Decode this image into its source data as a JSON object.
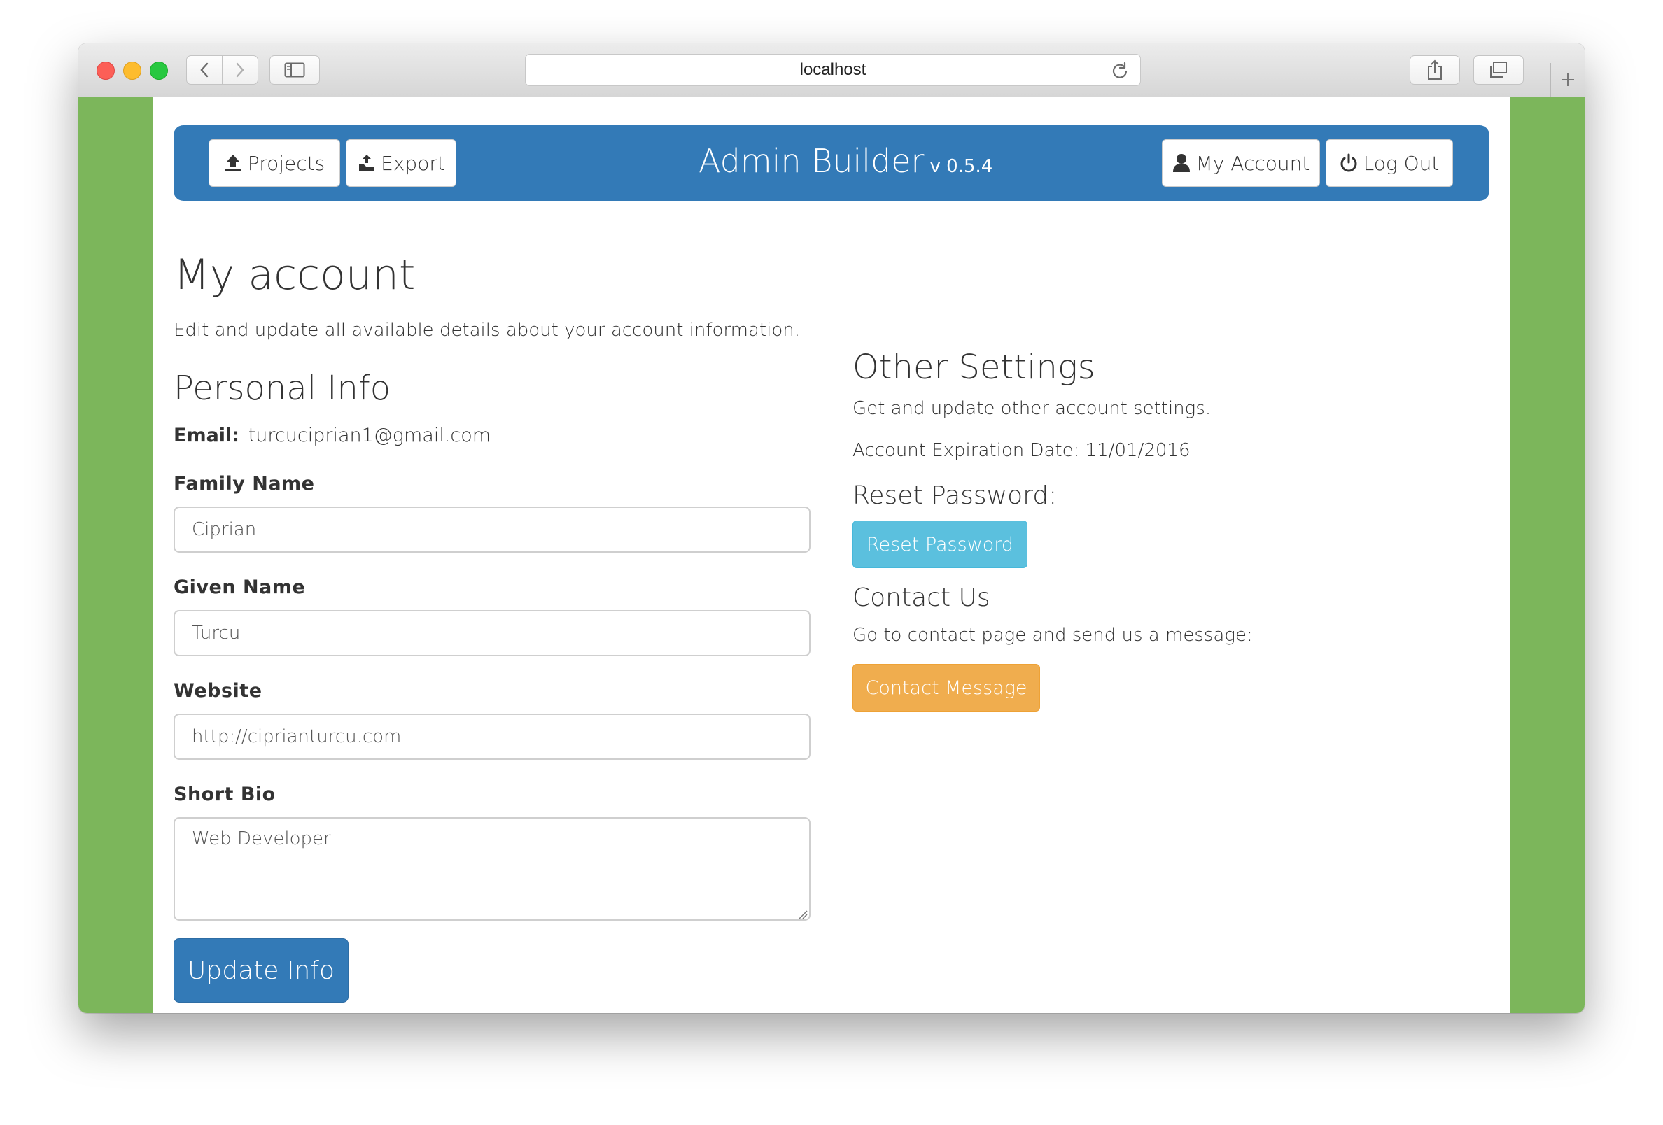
{
  "browser": {
    "url": "localhost"
  },
  "nav": {
    "projects_label": "Projects",
    "export_label": "Export",
    "brand_name": "Admin Builder",
    "brand_version": "v 0.5.4",
    "my_account_label": "My Account",
    "logout_label": "Log Out"
  },
  "main": {
    "title": "My account",
    "lead": "Edit and update all available details about your account information."
  },
  "personal": {
    "heading": "Personal Info",
    "email_label": "Email:",
    "email_value": "turcuciprian1@gmail.com",
    "family_name_label": "Family Name",
    "family_name_value": "Ciprian",
    "given_name_label": "Given Name",
    "given_name_value": "Turcu",
    "website_label": "Website",
    "website_value": "http://cipriantur cu.com",
    "short_bio_label": "Short Bio",
    "short_bio_value": "Web Developer",
    "update_button": "Update Info"
  },
  "settings": {
    "heading": "Other Settings",
    "description": "Get and update other account settings.",
    "expiration": "Account Expiration Date: 11/01/2016",
    "reset_heading": "Reset Password:",
    "reset_button": "Reset Password",
    "contact_heading": "Contact Us",
    "contact_text": "Go to contact page and send us a message:",
    "contact_button": "Contact Message"
  },
  "colors": {
    "navbar": "#337ab7",
    "page_background": "#7cb65b",
    "info": "#5bc0de",
    "warning": "#f0ad4e"
  },
  "icons": {
    "projects": "upload-icon",
    "export": "export-icon",
    "my_account": "user-icon",
    "logout": "power-icon"
  }
}
